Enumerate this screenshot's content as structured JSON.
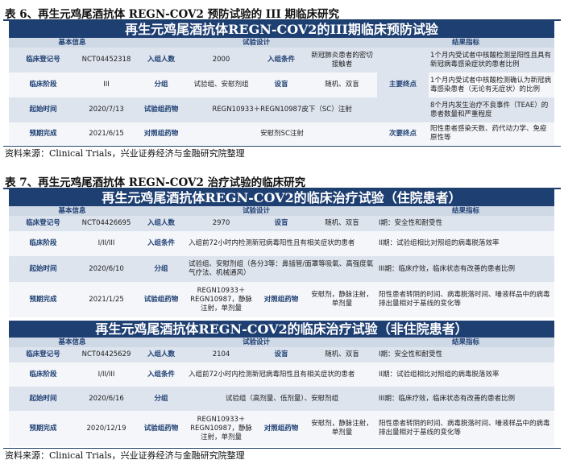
{
  "table6": {
    "title": "表 6、再生元鸡尾酒抗体 REGN-COV2 预防试验的 III 期临床研究",
    "banner": "再生元鸡尾酒抗体REGN-COV2的III期临床预防试验",
    "header": {
      "basic": "基本信息",
      "design": "试验设计",
      "endpoint": "结果指标"
    },
    "rows": [
      {
        "l1": "临床登记号",
        "v1": "NCT04452318",
        "l2": "入组人数",
        "v2": "2000",
        "l3": "入组条件",
        "v3": "新冠肺炎患者的密切接触者",
        "l4": "主要终点",
        "v4": "1个月内受试者中核酸检测呈阳性且具有新冠病毒感染症状的患者比例"
      },
      {
        "l1": "临床阶段",
        "v1": "III",
        "l2": "分组",
        "v2": "试验组、安慰剂组",
        "l3": "设盲",
        "v3": "随机、双盲",
        "l4": "",
        "v4": "1个月内受试者中核酸检测确认为新冠病毒感染患者（无论有无症状）的比例"
      },
      {
        "l1": "起始时间",
        "v1": "2020/7/13",
        "l2": "试验组药物",
        "v2": "REGN10933＋REGN10987皮下（SC）注射",
        "l4": "",
        "v4": "8个月内发生治疗不良事件（TEAE）的患者数量和严重程度"
      },
      {
        "l1": "预期完成",
        "v1": "2021/6/15",
        "l2": "对照组药物",
        "v2": "安慰剂SC注射",
        "l4": "次要终点",
        "v4": "阳性患者感染天数、药代动力学、免疫原性等"
      }
    ],
    "source": "资料来源：Clinical Trials，兴业证券经济与金融研究院整理"
  },
  "table7": {
    "title": "表 7、再生元鸡尾酒抗体 REGN-COV2 治疗试验的临床研究",
    "sections": [
      {
        "banner": "再生元鸡尾酒抗体REGN-COV2的临床治疗试验（住院患者）",
        "header": {
          "basic": "基本信息",
          "design": "试验设计",
          "endpoint": "结果指标"
        },
        "rows": [
          {
            "l1": "临床登记号",
            "v1": "NCT04426695",
            "l2": "入组人数",
            "v2": "2970",
            "l3": "设盲",
            "v3": "随机、双盲",
            "v4": "I期：安全性和耐受性"
          },
          {
            "l1": "临床阶段",
            "v1": "I/II/III",
            "l2": "入组条件",
            "v2": "入组前72小时内检测新冠病毒阳性且有相关症状的患者",
            "v4": "II期：试验组相比对照组的病毒脱落效率"
          },
          {
            "l1": "起始时间",
            "v1": "2020/6/10",
            "l2": "分组",
            "v2": "试验组、安慰剂组（各分3等：鼻插管/面罩等吸氧、高强度氧气疗法、机械通风）",
            "v4": "III期：临床疗效，临床状态有改善的患者比例"
          },
          {
            "l1": "预期完成",
            "v1": "2021/1/25",
            "l2": "试验组药物",
            "v2": "REGN10933＋REGN10987，静脉注射，单剂量",
            "l3": "对照组药物",
            "v3": "安慰剂，静脉注射，单剂量",
            "v4": "阳性患者转阴的时间、病毒脱落时间、唾液样品中的病毒排出量相对于基线的变化等"
          }
        ]
      },
      {
        "banner": "再生元鸡尾酒抗体REGN-COV2的临床治疗试验（非住院患者）",
        "header": {
          "basic": "基本信息",
          "design": "试验设计",
          "endpoint": "结果指标"
        },
        "rows": [
          {
            "l1": "临床登记号",
            "v1": "NCT04425629",
            "l2": "入组人数",
            "v2": "2104",
            "l3": "设盲",
            "v3": "随机、双盲",
            "v4": "I期：安全性和耐受性"
          },
          {
            "l1": "临床阶段",
            "v1": "I/II/III",
            "l2": "入组条件",
            "v2": "入组前72小时内检测新冠病毒阳性且有相关症状的患者",
            "v4": "II期：试验组相比对照组的病毒脱落效率"
          },
          {
            "l1": "起始时间",
            "v1": "2020/6/16",
            "l2": "分组",
            "v2": "试验组（高剂量、低剂量）、安慰剂组",
            "v4": "III期：临床疗效，临床状态有改善的患者比例"
          },
          {
            "l1": "预期完成",
            "v1": "2020/12/19",
            "l2": "试验组药物",
            "v2": "REGN10933＋REGN10987，静脉注射，单剂量",
            "l3": "对照组药物",
            "v3": "安慰剂，静脉注射，单剂量",
            "v4": "阳性患者转阴的时间、病毒脱落时间、唾液样品中的病毒排出量相对于基线的变化等"
          }
        ]
      }
    ],
    "source": "资料来源：Clinical Trials，兴业证券经济与金融研究院整理"
  }
}
